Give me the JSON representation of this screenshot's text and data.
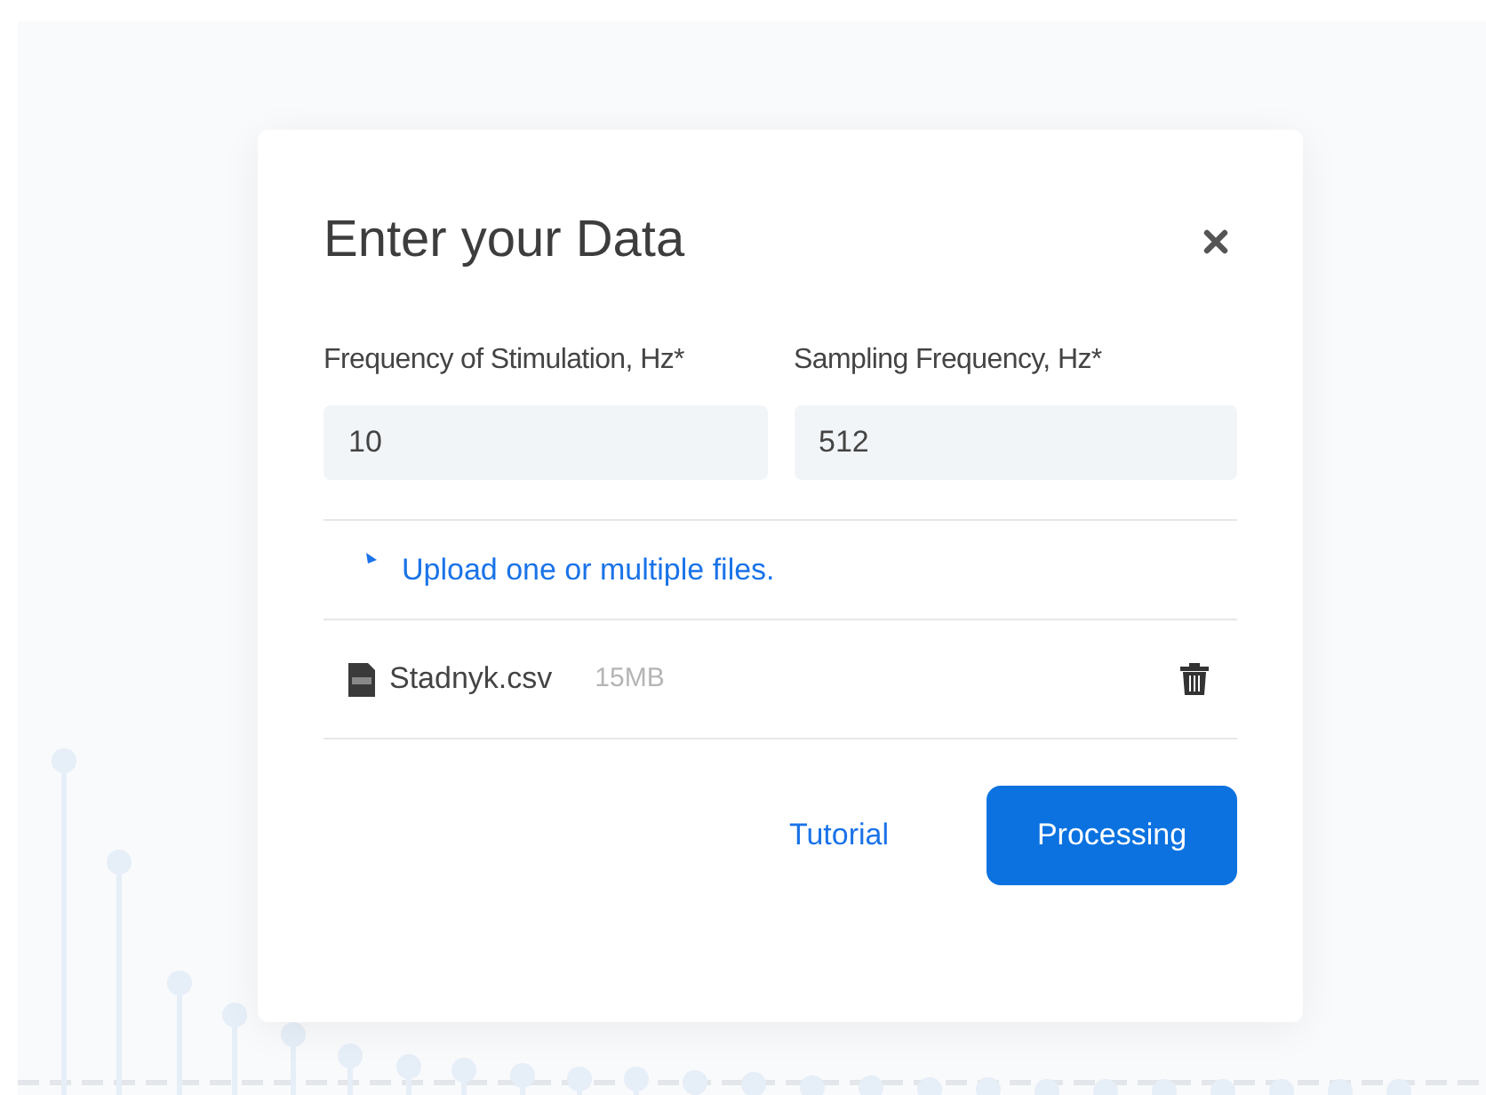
{
  "dialog": {
    "title": "Enter your Data",
    "fields": [
      {
        "label": "Frequency of Stimulation, Hz*",
        "value": "10"
      },
      {
        "label": "Sampling Frequency, Hz*",
        "value": "512"
      }
    ],
    "upload_link": "Upload one or multiple files.",
    "files": [
      {
        "name": "Stadnyk.csv",
        "size": "15MB"
      }
    ],
    "buttons": [
      {
        "kind": "link",
        "label": "Tutorial"
      },
      {
        "kind": "primary",
        "label": "Processing"
      }
    ]
  }
}
